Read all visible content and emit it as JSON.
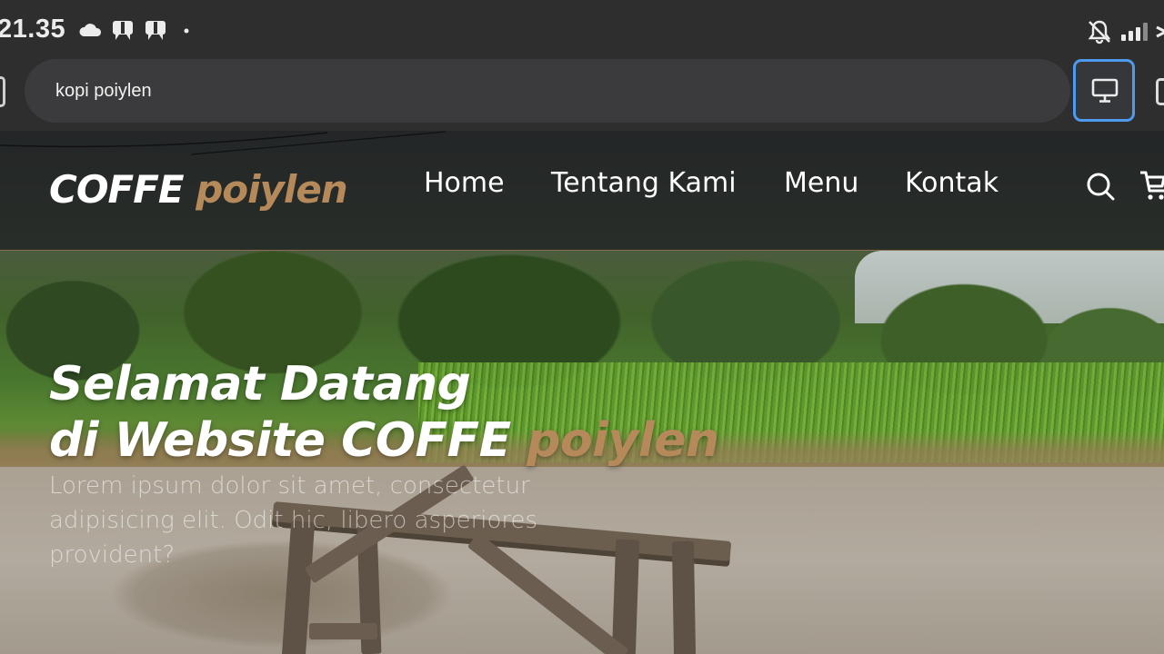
{
  "status_bar": {
    "time": "21.35",
    "left_icons": [
      "cloud-icon",
      "notification-icon",
      "notification-icon",
      "dot-icon"
    ],
    "right_icons": [
      "bell-off-icon",
      "signal-icon",
      "wifi-icon"
    ]
  },
  "browser": {
    "url_text": "kopi poiylen",
    "desktop_mode_active": true,
    "accent_color": "#4d9aee"
  },
  "site": {
    "brand": {
      "main": "COFFE",
      "accent": "poiylen"
    },
    "nav": [
      {
        "label": "Home"
      },
      {
        "label": "Tentang Kami"
      },
      {
        "label": "Menu"
      },
      {
        "label": "Kontak"
      }
    ],
    "icons": [
      "search-icon",
      "cart-icon"
    ],
    "hero": {
      "line1": "Selamat Datang",
      "line2_main": "di Website COFFE ",
      "line2_accent": "poiylen",
      "paragraph": "Lorem ipsum dolor sit amet, consectetur adipisicing elit. Odit hic, libero asperiores provident?"
    },
    "colors": {
      "accent": "#b6895b",
      "text": "#ffffff"
    }
  }
}
